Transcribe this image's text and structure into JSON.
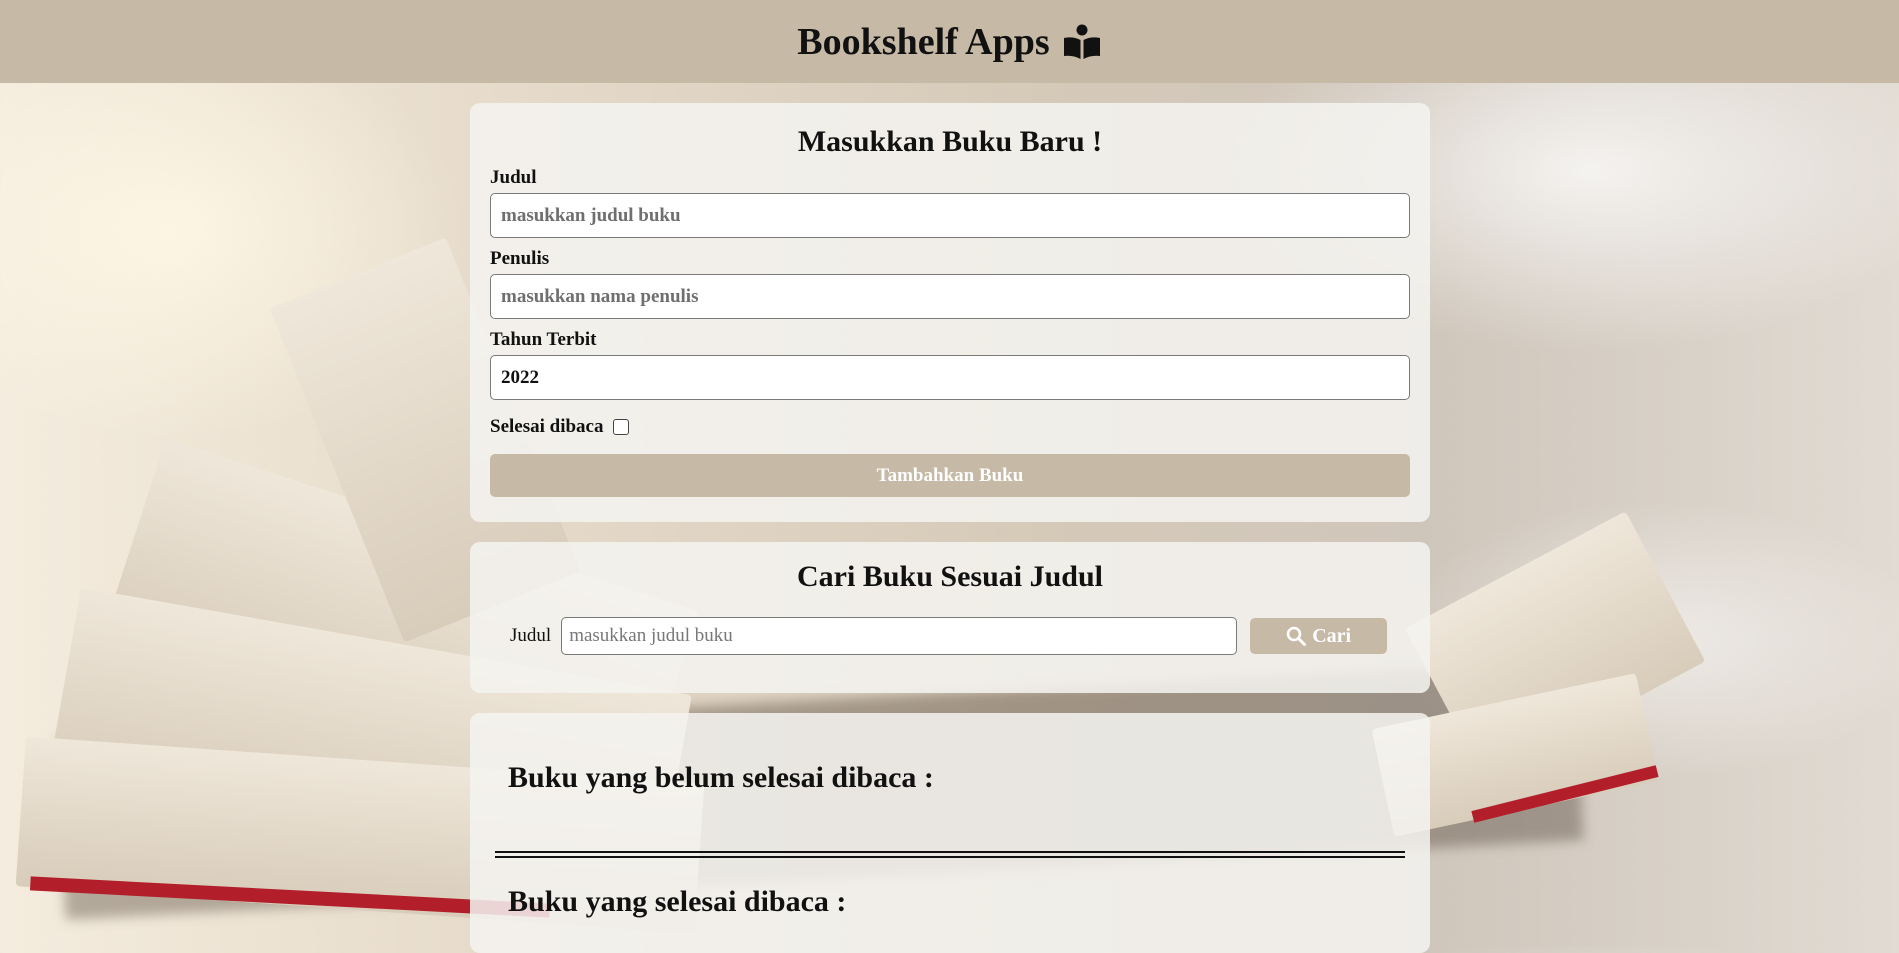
{
  "header": {
    "title": "Bookshelf Apps",
    "icon": "open-book-reader-icon"
  },
  "input_form": {
    "title": "Masukkan Buku Baru !",
    "title_field": {
      "label": "Judul",
      "placeholder": "masukkan judul buku",
      "value": ""
    },
    "author_field": {
      "label": "Penulis",
      "placeholder": "masukkan nama penulis",
      "value": ""
    },
    "year_field": {
      "label": "Tahun Terbit",
      "value": "2022"
    },
    "complete_checkbox": {
      "label": "Selesai dibaca",
      "checked": false
    },
    "submit_label": "Tambahkan Buku"
  },
  "search": {
    "title": "Cari Buku Sesuai Judul",
    "label": "Judul",
    "placeholder": "masukkan judul buku",
    "button_label": "Cari",
    "button_icon": "search-icon"
  },
  "shelves": {
    "incomplete_title": "Buku yang belum selesai dibaca :",
    "complete_title": "Buku yang selesai dibaca :"
  },
  "colors": {
    "accent": "#c6b9a6",
    "card_bg": "#f5f3f0",
    "text": "#111111"
  }
}
